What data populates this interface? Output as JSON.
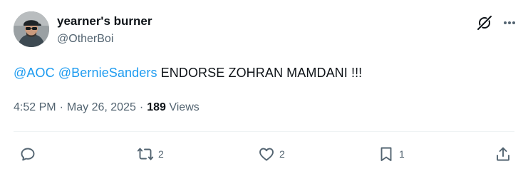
{
  "user": {
    "display_name": "yearner's burner",
    "handle": "@OtherBoi"
  },
  "tweet": {
    "mentions": [
      "@AOC",
      "@BernieSanders"
    ],
    "body": "ENDORSE ZOHRAN MAMDANI !!!"
  },
  "meta": {
    "time": "4:52 PM",
    "date": "May 26, 2025",
    "separator": "·",
    "views_count": "189",
    "views_label": "Views"
  },
  "actions": {
    "reply_count": "",
    "repost_count": "2",
    "like_count": "2",
    "bookmark_count": "1"
  },
  "icons": {
    "header": [
      "grok-icon",
      "more-icon"
    ],
    "actions": [
      "reply-icon",
      "repost-icon",
      "like-icon",
      "bookmark-icon",
      "share-icon"
    ]
  },
  "colors": {
    "text": "#0f1419",
    "secondary": "#536471",
    "link": "#1d9bf0",
    "divider": "#eff3f4"
  }
}
